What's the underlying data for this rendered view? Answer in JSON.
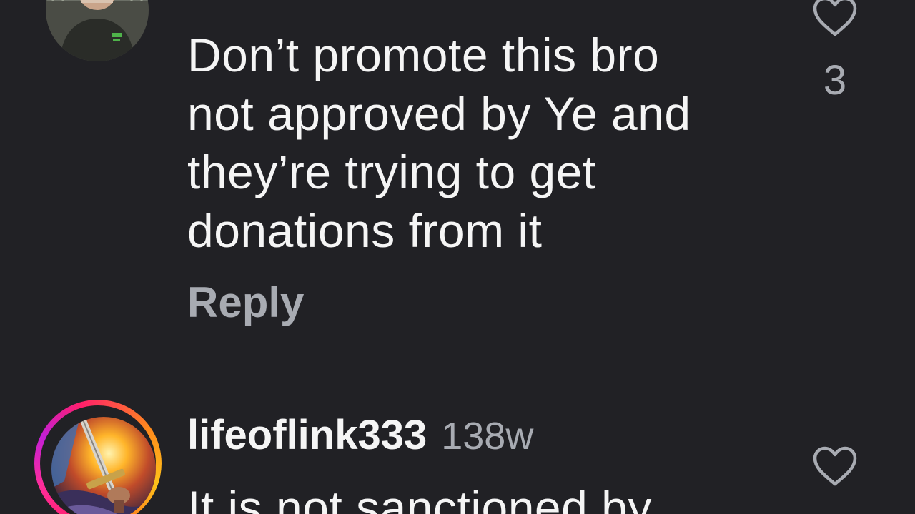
{
  "comments": [
    {
      "text": "Don’t promote this bro\nnot approved by Ye and\nthey’re trying to get\ndonations from it",
      "reply_label": "Reply",
      "like_count": "3",
      "avatar_icon": "user-avatar-photo",
      "like_icon": "heart-outline-icon"
    },
    {
      "username": "lifeoflink333",
      "timestamp": "138w",
      "text": "It is not sanctioned by",
      "avatar_icon": "user-avatar-story-ring",
      "like_icon": "heart-outline-icon"
    }
  ],
  "theme": {
    "background": "#212125",
    "text_primary": "#f5f5f5",
    "text_secondary": "#a8abb2",
    "story_ring_start": "#ff1f6b",
    "story_ring_end": "#ffc21a"
  }
}
